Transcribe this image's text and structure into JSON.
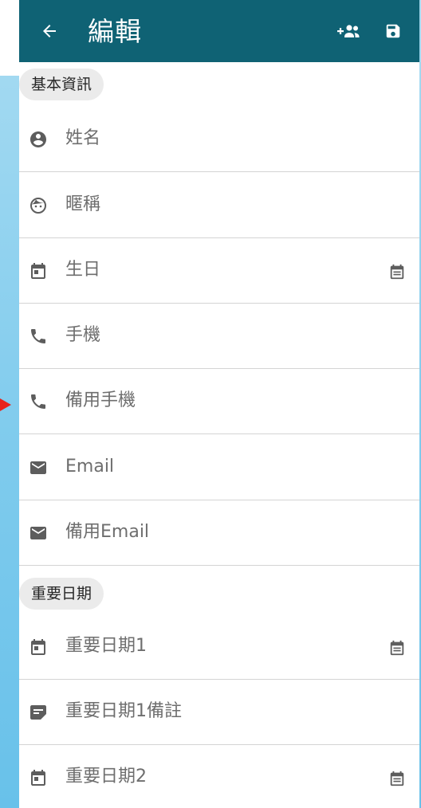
{
  "colors": {
    "appbar": "#0f6274",
    "chip_bg": "#ebebeb",
    "icon": "#5d5d5d",
    "pointer": "#e8231a"
  },
  "header": {
    "title": "編輯",
    "icons": {
      "back": "arrow-back-icon",
      "add_people": "group-add-icon",
      "save": "save-icon"
    }
  },
  "sections": {
    "basic": {
      "label": "基本資訊"
    },
    "important_dates": {
      "label": "重要日期"
    }
  },
  "fields": {
    "name": {
      "label": "姓名",
      "icon": "account-circle-icon"
    },
    "nickname": {
      "label": "暱稱",
      "icon": "face-icon"
    },
    "birthday": {
      "label": "生日",
      "icon": "event-icon",
      "trailing_icon": "calendar-picker-icon"
    },
    "mobile": {
      "label": "手機",
      "icon": "phone-icon"
    },
    "alt_mobile": {
      "label": "備用手機",
      "icon": "phone-icon"
    },
    "email": {
      "label": "Email",
      "icon": "mail-icon"
    },
    "alt_email": {
      "label": "備用Email",
      "icon": "mail-icon"
    },
    "date1": {
      "label": "重要日期1",
      "icon": "event-icon",
      "trailing_icon": "calendar-picker-icon"
    },
    "date1_note": {
      "label": "重要日期1備註",
      "icon": "note-icon"
    },
    "date2": {
      "label": "重要日期2",
      "icon": "event-icon",
      "trailing_icon": "calendar-picker-icon"
    }
  }
}
